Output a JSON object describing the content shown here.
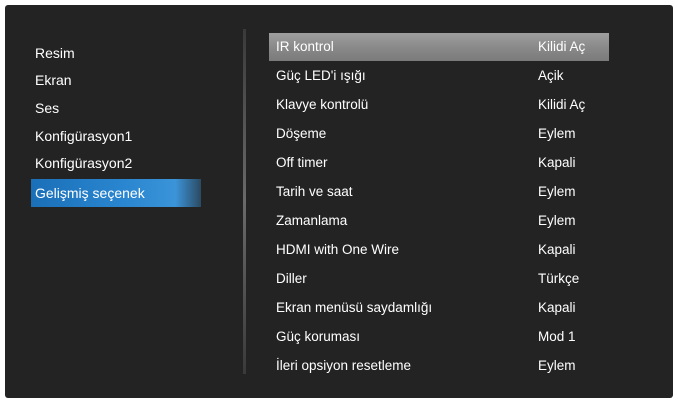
{
  "left_menu": {
    "items": [
      {
        "label": "Resim"
      },
      {
        "label": "Ekran"
      },
      {
        "label": "Ses"
      },
      {
        "label": "Konfigürasyon1"
      },
      {
        "label": "Konfigürasyon2"
      },
      {
        "label": "Gelişmiş seçenek"
      }
    ],
    "active_index": 5
  },
  "settings": {
    "selected_index": 0,
    "rows": [
      {
        "label": "IR kontrol",
        "value": "Kilidi Aç"
      },
      {
        "label": "Güç LED'i ışığı",
        "value": "Açik"
      },
      {
        "label": "Klavye kontrolü",
        "value": "Kilidi Aç"
      },
      {
        "label": "Döşeme",
        "value": "Eylem"
      },
      {
        "label": "Off timer",
        "value": "Kapali"
      },
      {
        "label": "Tarih ve saat",
        "value": "Eylem"
      },
      {
        "label": "Zamanlama",
        "value": "Eylem"
      },
      {
        "label": "HDMI with One Wire",
        "value": "Kapali"
      },
      {
        "label": "Diller",
        "value": "Türkçe"
      },
      {
        "label": "Ekran menüsü saydamlığı",
        "value": "Kapali"
      },
      {
        "label": "Güç koruması",
        "value": "Mod 1"
      },
      {
        "label": "İleri opsiyon resetleme",
        "value": "Eylem"
      }
    ]
  },
  "colors": {
    "background": "#232323",
    "active_item": "#2a86d0",
    "selected_row": "#8a8a8a",
    "text": "#ffffff"
  }
}
